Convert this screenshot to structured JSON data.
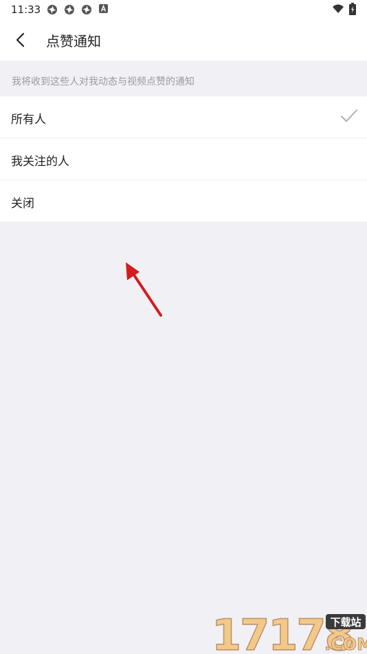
{
  "status_bar": {
    "time": "11:33",
    "notification_icons": [
      "aperture-icon",
      "aperture-icon",
      "aperture-icon",
      "a-badge-icon"
    ],
    "right_icons": [
      "wifi-icon",
      "battery-icon"
    ]
  },
  "header": {
    "back_icon": "chevron-left-icon",
    "title": "点赞通知"
  },
  "hint": "我将收到这些人对我动态与视频点赞的通知",
  "options": [
    {
      "label": "所有人",
      "selected": true
    },
    {
      "label": "我关注的人",
      "selected": false
    },
    {
      "label": "关闭",
      "selected": false
    }
  ],
  "colors": {
    "background": "#f1f1f5",
    "surface": "#ffffff",
    "hint_text": "#9a9aa0",
    "check": "#b0b0b0",
    "annotation_arrow": "#d41c1c"
  },
  "watermark": {
    "number": "17178",
    "badge": "下载站",
    "domain": ".COM"
  }
}
